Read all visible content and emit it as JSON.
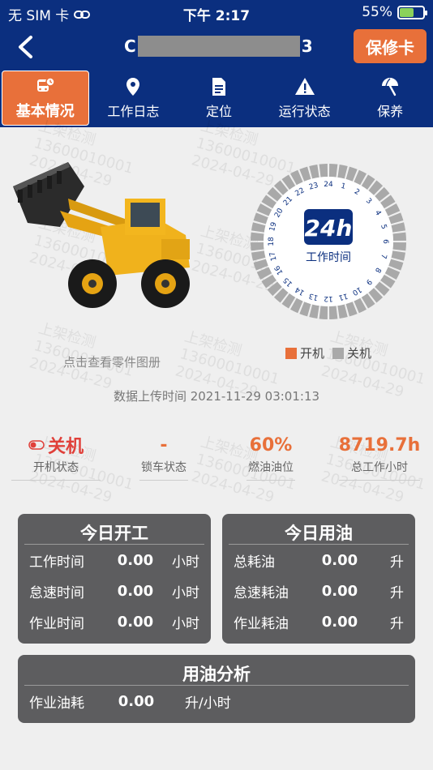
{
  "status_bar": {
    "carrier": "无 SIM 卡",
    "time": "下午 2:17",
    "battery": "55%",
    "battery_level": 0.55
  },
  "header": {
    "title_prefix": "C",
    "title_suffix": "3",
    "warranty_label": "保修卡"
  },
  "tabs": [
    {
      "label": "基本情况",
      "icon": "bus-clock-icon",
      "active": true
    },
    {
      "label": "工作日志",
      "icon": "location-pin-icon"
    },
    {
      "label": "定位",
      "icon": "document-icon"
    },
    {
      "label": "运行状态",
      "icon": "warning-icon"
    },
    {
      "label": "保养",
      "icon": "umbrella-icon"
    }
  ],
  "watermark": {
    "line1": "上架检测",
    "line2": "13600010001",
    "line3": "2024-04-29"
  },
  "dial": {
    "badge": "24h",
    "label": "工作时间",
    "hours": [
      "24",
      "1",
      "2",
      "3",
      "4",
      "5",
      "6",
      "7",
      "8",
      "9",
      "10",
      "11",
      "12",
      "13",
      "14",
      "15",
      "16",
      "17",
      "18",
      "19",
      "20",
      "21",
      "22",
      "23"
    ]
  },
  "legend": {
    "on": "开机",
    "off": "关机",
    "on_color": "#e8703a",
    "off_color": "#a9a9a9"
  },
  "parts_link": "点击查看零件图册",
  "upload_time": "数据上传时间 2021-11-29 03:01:13",
  "stats": {
    "power": {
      "value": "关机",
      "label": "开机状态",
      "color": "#e0403a"
    },
    "lock": {
      "value": "-",
      "label": "锁车状态",
      "color": "#e8703a"
    },
    "fuel": {
      "value": "60%",
      "label": "燃油油位",
      "color": "#e8703a"
    },
    "hours": {
      "value": "8719.7h",
      "label": "总工作小时",
      "color": "#e8703a"
    }
  },
  "today_work": {
    "title": "今日开工",
    "rows": [
      {
        "label": "工作时间",
        "value": "0.00",
        "unit": "小时"
      },
      {
        "label": "怠速时间",
        "value": "0.00",
        "unit": "小时"
      },
      {
        "label": "作业时间",
        "value": "0.00",
        "unit": "小时"
      }
    ]
  },
  "today_fuel": {
    "title": "今日用油",
    "rows": [
      {
        "label": "总耗油",
        "value": "0.00",
        "unit": "升"
      },
      {
        "label": "怠速耗油",
        "value": "0.00",
        "unit": "升"
      },
      {
        "label": "作业耗油",
        "value": "0.00",
        "unit": "升"
      }
    ]
  },
  "fuel_analysis": {
    "title": "用油分析",
    "rows": [
      {
        "label": "作业油耗",
        "value": "0.00",
        "unit": "升/小时"
      }
    ]
  }
}
